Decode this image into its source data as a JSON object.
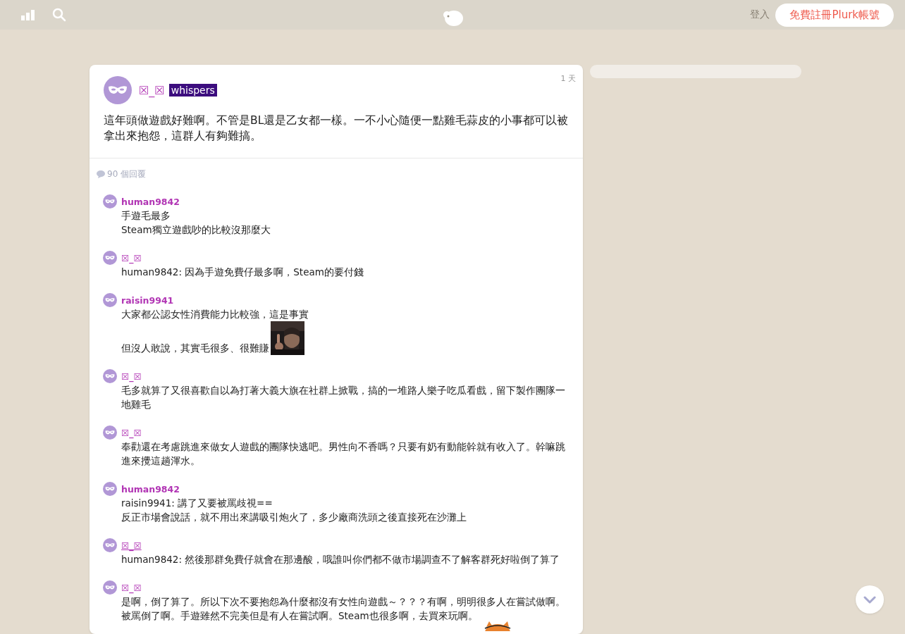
{
  "top_bar": {
    "login": "登入",
    "signup": "免費註冊Plurk帳號"
  },
  "post": {
    "author": "☒_☒",
    "qualifier": "whispers",
    "time": "1 天",
    "content": "這年頭做遊戲好難啊。不管是BL還是乙女都一樣。一不小心隨便一點雞毛蒜皮的小事都可以被拿出來抱怨，這群人有夠難搞。",
    "response_count": "90 個回覆"
  },
  "responses": [
    {
      "user": "human9842",
      "hovered": false,
      "lines": [
        "手遊毛最多",
        "Steam獨立遊戲吵的比較沒那麼大"
      ]
    },
    {
      "user": "☒_☒",
      "hovered": false,
      "lines": [
        "human9842: 因為手遊免費仔最多啊，Steam的要付錢"
      ]
    },
    {
      "user": "raisin9941",
      "hovered": false,
      "lines": [
        "大家都公認女性消費能力比較強，這是事實",
        "但沒人敢說，其實毛很多、很難賺"
      ],
      "attachment": {
        "kind": "picture"
      }
    },
    {
      "user": "☒_☒",
      "hovered": false,
      "lines": [
        "毛多就算了又很喜歡自以為打著大義大旗在社群上掀戰，搞的一堆路人樂子吃瓜看戲，留下製作團隊一地雞毛"
      ]
    },
    {
      "user": "☒_☒",
      "hovered": false,
      "lines": [
        "奉勸還在考慮跳進來做女人遊戲的團隊快逃吧。男性向不香嗎？只要有奶有動能幹就有收入了。幹嘛跳進來攪這趟渾水。"
      ]
    },
    {
      "user": "human9842",
      "hovered": false,
      "lines": [
        "raisin9941: 講了又要被罵歧視==",
        "反正市場會說話，就不用出來講吸引炮火了，多少廠商洗頭之後直接死在沙灘上"
      ]
    },
    {
      "user": "☒_☒",
      "hovered": true,
      "lines": [
        "human9842: 然後那群免費仔就會在那邊酸，哦誰叫你們都不做市場調查不了解客群死好啦倒了算了"
      ]
    },
    {
      "user": "☒_☒",
      "hovered": false,
      "lines": [
        "是啊，倒了算了。所以下次不要抱怨為什麼都沒有女性向遊戲～？？？有啊，明明很多人在嘗試做啊。被罵倒了啊。手遊雖然不完美但是有人在嘗試啊。Steam也很多啊，去買來玩啊。"
      ],
      "attachment": {
        "kind": "picture"
      }
    }
  ]
}
